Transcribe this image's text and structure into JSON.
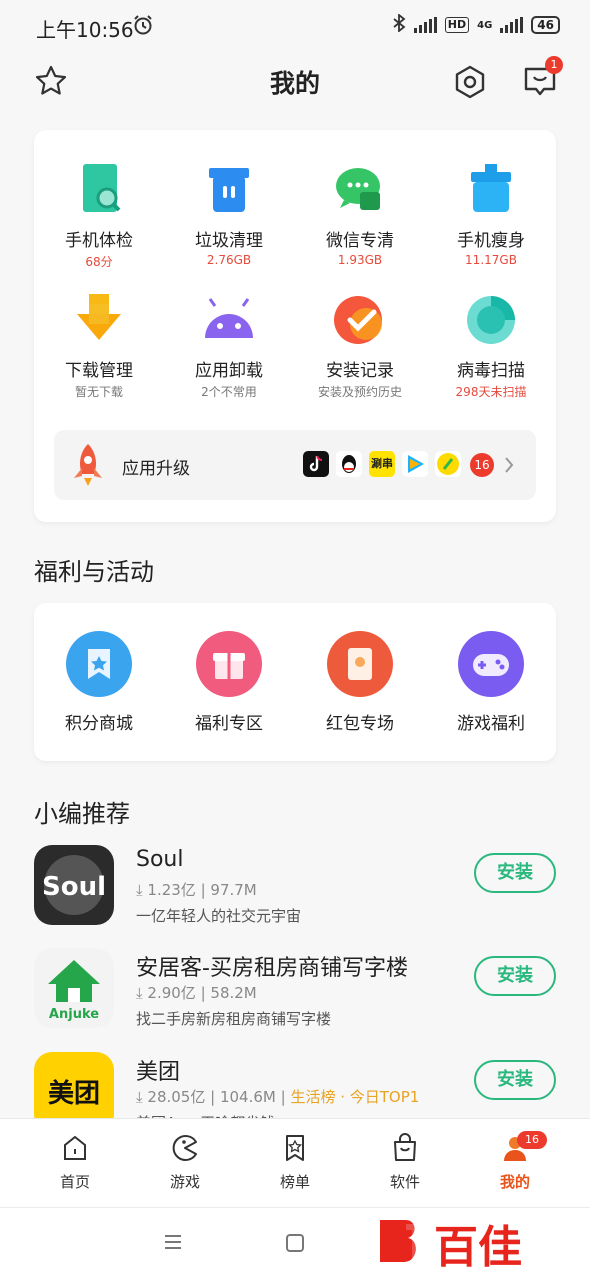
{
  "status": {
    "time": "上午10:56",
    "battery": "46",
    "hd": "HD",
    "net": "4G"
  },
  "header": {
    "title": "我的",
    "message_badge": "1"
  },
  "tools": [
    {
      "label": "手机体检",
      "sub": "68分",
      "sub_red": true,
      "icon": "phone-check-icon"
    },
    {
      "label": "垃圾清理",
      "sub": "2.76GB",
      "sub_red": true,
      "icon": "trash-icon"
    },
    {
      "label": "微信专清",
      "sub": "1.93GB",
      "sub_red": true,
      "icon": "wechat-icon"
    },
    {
      "label": "手机瘦身",
      "sub": "11.17GB",
      "sub_red": true,
      "icon": "slim-icon"
    },
    {
      "label": "下载管理",
      "sub": "暂无下载",
      "sub_red": false,
      "icon": "download-icon"
    },
    {
      "label": "应用卸载",
      "sub": "2个不常用",
      "sub_red": false,
      "icon": "android-icon"
    },
    {
      "label": "安装记录",
      "sub": "安装及预约历史",
      "sub_red": false,
      "icon": "check-icon"
    },
    {
      "label": "病毒扫描",
      "sub": "298天未扫描",
      "sub_red": true,
      "icon": "virus-scan-icon"
    }
  ],
  "upgrade": {
    "label": "应用升级",
    "count": "16",
    "app_badge_text": "涮串"
  },
  "welfare_title": "福利与活动",
  "welfare": [
    {
      "label": "积分商城",
      "color": "#3ba4ee"
    },
    {
      "label": "福利专区",
      "color": "#f05b7e"
    },
    {
      "label": "红包专场",
      "color": "#ee5a3c"
    },
    {
      "label": "游戏福利",
      "color": "#7b5cf0"
    }
  ],
  "rec_title": "小编推荐",
  "recs": [
    {
      "name": "Soul",
      "downloads": "1.23亿",
      "size": "97.7M",
      "hot": "",
      "desc": "一亿年轻人的社交元宇宙",
      "install": "安装",
      "logo": "Soul"
    },
    {
      "name": "安居客-买房租房商铺写字楼",
      "downloads": "2.90亿",
      "size": "58.2M",
      "hot": "",
      "desc": "找二手房新房租房商铺写字楼",
      "install": "安装",
      "logo": "Anjuke"
    },
    {
      "name": "美团",
      "downloads": "28.05亿",
      "size": "104.6M",
      "hot": "生活榜 · 今日TOP1",
      "desc": "美团App 干啥都省钱",
      "install": "安装",
      "logo": "美团"
    }
  ],
  "tabs": [
    {
      "label": "首页",
      "icon": "home-icon"
    },
    {
      "label": "游戏",
      "icon": "game-icon"
    },
    {
      "label": "榜单",
      "icon": "ranking-icon"
    },
    {
      "label": "软件",
      "icon": "software-icon"
    },
    {
      "label": "我的",
      "icon": "me-icon",
      "badge": "16"
    }
  ],
  "watermark": "百佳"
}
